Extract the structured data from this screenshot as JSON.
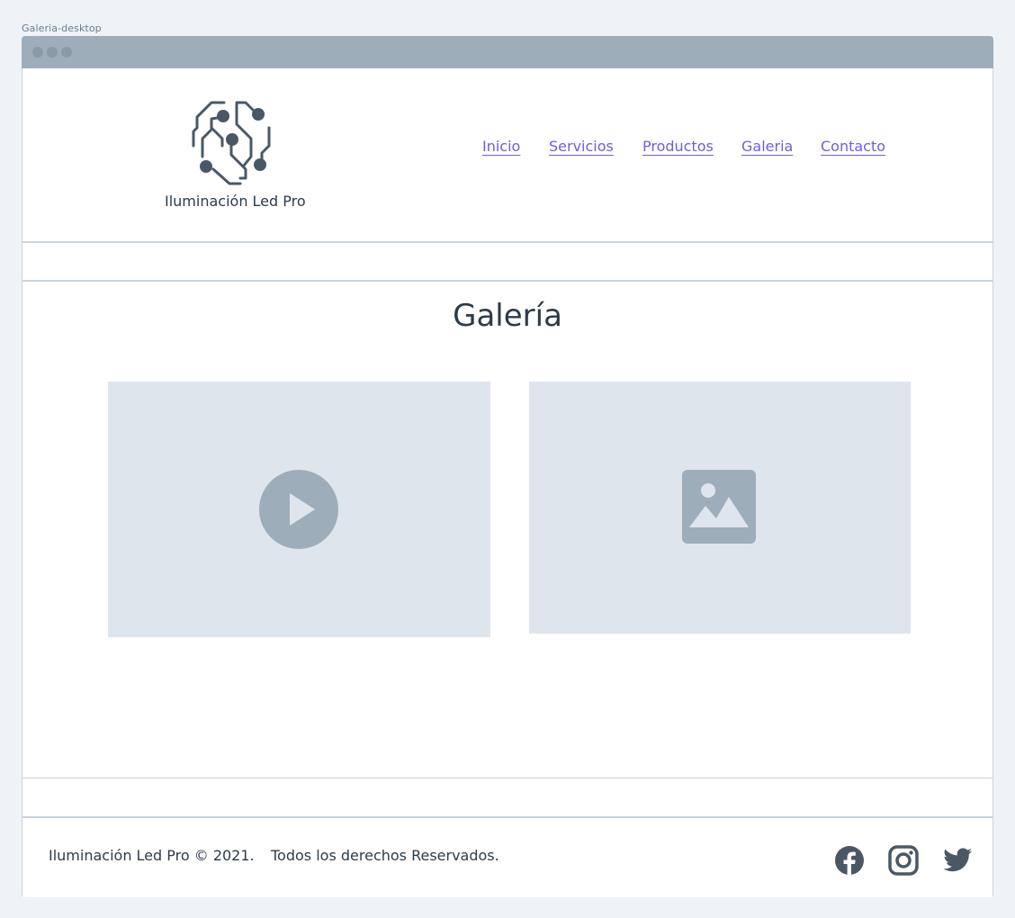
{
  "frame": {
    "title": "Galeria-desktop"
  },
  "header": {
    "brand_name": "Iluminación Led Pro",
    "nav": [
      "Inicio",
      "Servicios",
      "Productos",
      "Galeria",
      "Contacto"
    ]
  },
  "main": {
    "title": "Galería",
    "gallery": [
      {
        "type": "video",
        "icon": "play-icon"
      },
      {
        "type": "image",
        "icon": "image-icon"
      }
    ]
  },
  "footer": {
    "copyright": "Iluminación Led Pro © 2021.",
    "rights": "Todos los derechos Reservados.",
    "social": [
      "facebook-icon",
      "instagram-icon",
      "twitter-icon"
    ]
  },
  "colors": {
    "link": "#6b5fe0",
    "text": "#2d3b4a",
    "placeholder_bg": "#dfe5ec",
    "placeholder_icon": "#9eadba",
    "titlebar": "#9eadba"
  }
}
